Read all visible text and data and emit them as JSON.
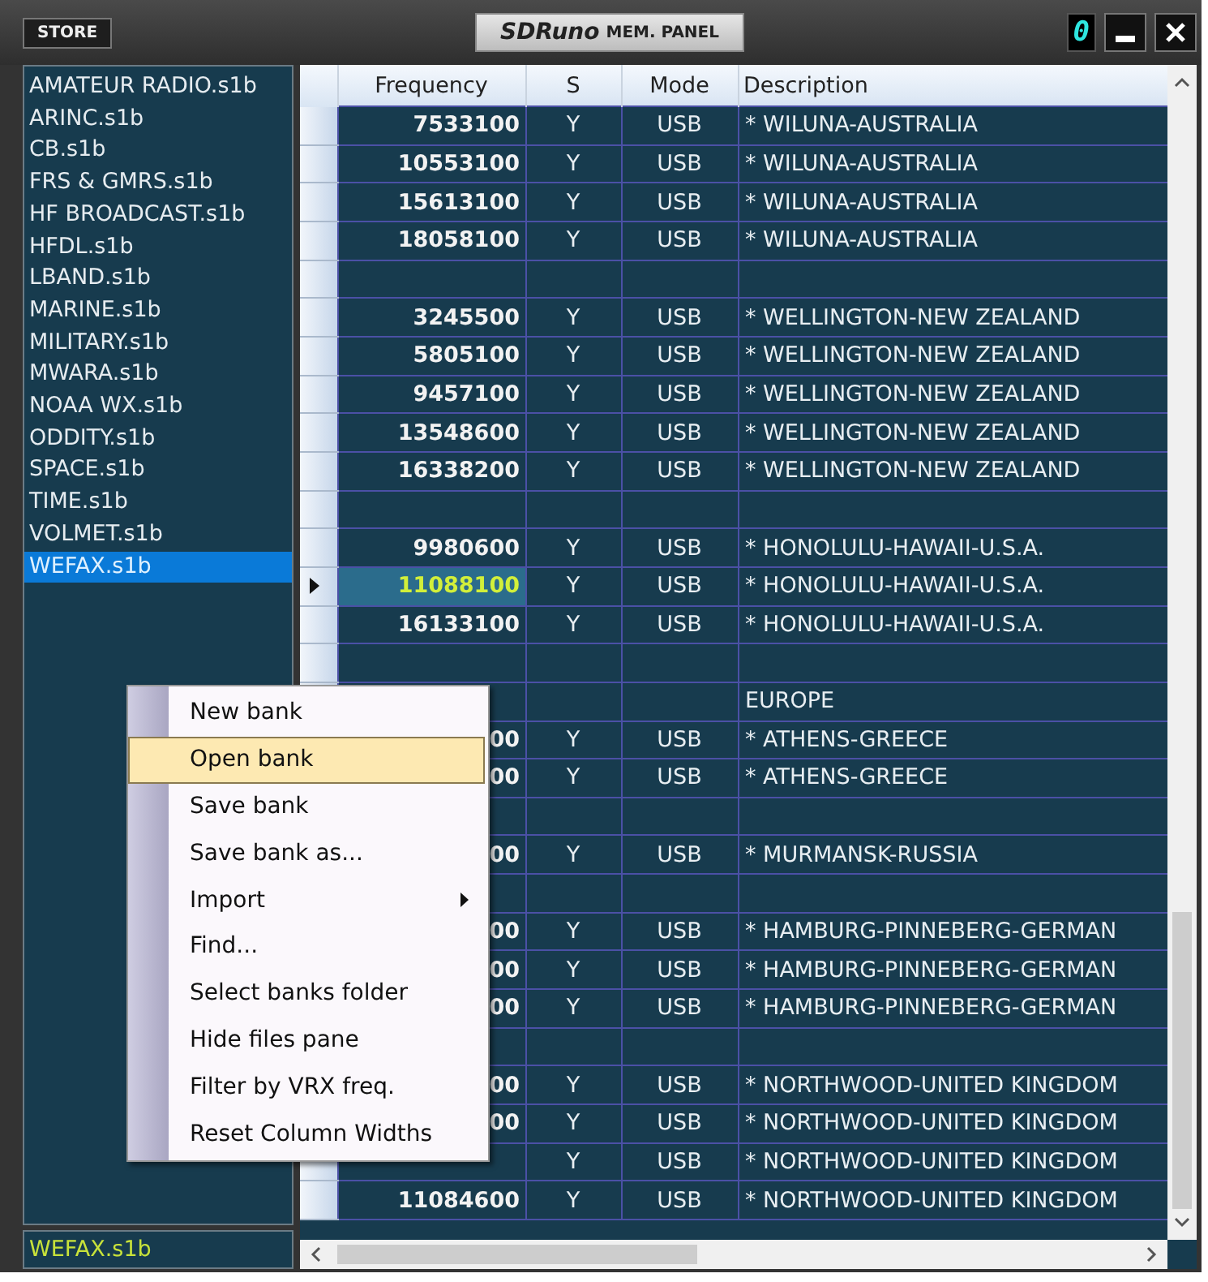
{
  "title_bar": {
    "store_button": "STORE",
    "title_brand": "SDRuno",
    "title_text": "MEM. PANEL",
    "channel_digit": "0"
  },
  "files": {
    "items": [
      {
        "label": "AMATEUR RADIO.s1b",
        "selected": false
      },
      {
        "label": "ARINC.s1b",
        "selected": false
      },
      {
        "label": "CB.s1b",
        "selected": false
      },
      {
        "label": "FRS & GMRS.s1b",
        "selected": false
      },
      {
        "label": "HF BROADCAST.s1b",
        "selected": false
      },
      {
        "label": "HFDL.s1b",
        "selected": false
      },
      {
        "label": "LBAND.s1b",
        "selected": false
      },
      {
        "label": "MARINE.s1b",
        "selected": false
      },
      {
        "label": "MILITARY.s1b",
        "selected": false
      },
      {
        "label": "MWARA.s1b",
        "selected": false
      },
      {
        "label": "NOAA WX.s1b",
        "selected": false
      },
      {
        "label": "ODDITY.s1b",
        "selected": false
      },
      {
        "label": "SPACE.s1b",
        "selected": false
      },
      {
        "label": "TIME.s1b",
        "selected": false
      },
      {
        "label": "VOLMET.s1b",
        "selected": false
      },
      {
        "label": "WEFAX.s1b",
        "selected": true
      }
    ],
    "status": "WEFAX.s1b"
  },
  "table": {
    "columns": [
      "Frequency",
      "S",
      "Mode",
      "Description"
    ],
    "rows": [
      {
        "frequency": "7533100",
        "s": "Y",
        "mode": "USB",
        "description": "* WILUNA-AUSTRALIA",
        "current": false
      },
      {
        "frequency": "10553100",
        "s": "Y",
        "mode": "USB",
        "description": "* WILUNA-AUSTRALIA",
        "current": false
      },
      {
        "frequency": "15613100",
        "s": "Y",
        "mode": "USB",
        "description": "* WILUNA-AUSTRALIA",
        "current": false
      },
      {
        "frequency": "18058100",
        "s": "Y",
        "mode": "USB",
        "description": "* WILUNA-AUSTRALIA",
        "current": false
      },
      {
        "current": false
      },
      {
        "frequency": "3245500",
        "s": "Y",
        "mode": "USB",
        "description": "* WELLINGTON-NEW ZEALAND",
        "current": false
      },
      {
        "frequency": "5805100",
        "s": "Y",
        "mode": "USB",
        "description": "* WELLINGTON-NEW ZEALAND",
        "current": false
      },
      {
        "frequency": "9457100",
        "s": "Y",
        "mode": "USB",
        "description": "* WELLINGTON-NEW ZEALAND",
        "current": false
      },
      {
        "frequency": "13548600",
        "s": "Y",
        "mode": "USB",
        "description": "* WELLINGTON-NEW ZEALAND",
        "current": false
      },
      {
        "frequency": "16338200",
        "s": "Y",
        "mode": "USB",
        "description": "* WELLINGTON-NEW ZEALAND",
        "current": false
      },
      {
        "current": false
      },
      {
        "frequency": "9980600",
        "s": "Y",
        "mode": "USB",
        "description": "* HONOLULU-HAWAII-U.S.A.",
        "current": false
      },
      {
        "frequency": "11088100",
        "s": "Y",
        "mode": "USB",
        "description": "* HONOLULU-HAWAII-U.S.A.",
        "current": true
      },
      {
        "frequency": "16133100",
        "s": "Y",
        "mode": "USB",
        "description": "* HONOLULU-HAWAII-U.S.A.",
        "current": false
      },
      {
        "current": false
      },
      {
        "description": "EUROPE",
        "current": false
      },
      {
        "frequency": "00",
        "s": "Y",
        "mode": "USB",
        "description": "* ATHENS-GREECE",
        "current": false
      },
      {
        "frequency": "00",
        "s": "Y",
        "mode": "USB",
        "description": "* ATHENS-GREECE",
        "current": false
      },
      {
        "current": false
      },
      {
        "frequency": "00",
        "s": "Y",
        "mode": "USB",
        "description": "* MURMANSK-RUSSIA",
        "current": false
      },
      {
        "current": false
      },
      {
        "frequency": "00",
        "s": "Y",
        "mode": "USB",
        "description": "* HAMBURG-PINNEBERG-GERMAN",
        "current": false
      },
      {
        "frequency": "00",
        "s": "Y",
        "mode": "USB",
        "description": "* HAMBURG-PINNEBERG-GERMAN",
        "current": false
      },
      {
        "frequency": "00",
        "s": "Y",
        "mode": "USB",
        "description": "* HAMBURG-PINNEBERG-GERMAN",
        "current": false
      },
      {
        "current": false
      },
      {
        "frequency": "00",
        "s": "Y",
        "mode": "USB",
        "description": "* NORTHWOOD-UNITED KINGDOM",
        "current": false
      },
      {
        "frequency": "00",
        "s": "Y",
        "mode": "USB",
        "description": "* NORTHWOOD-UNITED KINGDOM",
        "current": false
      },
      {
        "s": "Y",
        "mode": "USB",
        "description": "* NORTHWOOD-UNITED KINGDOM",
        "current": false
      },
      {
        "frequency": "11084600",
        "s": "Y",
        "mode": "USB",
        "description": "* NORTHWOOD-UNITED KINGDOM",
        "current": false
      }
    ]
  },
  "context_menu": {
    "items": [
      {
        "label": "New bank",
        "selected": false,
        "kind": "plain"
      },
      {
        "label": "Open bank",
        "selected": true,
        "kind": "plain"
      },
      {
        "label": "Save bank",
        "selected": false,
        "kind": "plain"
      },
      {
        "label": "Save bank as...",
        "selected": false,
        "kind": "plain"
      },
      {
        "label": "Import",
        "selected": false,
        "kind": "submenu"
      },
      {
        "label": "Find...",
        "selected": false,
        "kind": "plain"
      },
      {
        "label": "Select banks folder",
        "selected": false,
        "kind": "plain"
      },
      {
        "label": "Hide files pane",
        "selected": false,
        "kind": "plain"
      },
      {
        "label": "Filter by VRX freq.",
        "selected": false,
        "kind": "plain"
      },
      {
        "label": "Reset Column Widths",
        "selected": false,
        "kind": "plain"
      }
    ]
  }
}
